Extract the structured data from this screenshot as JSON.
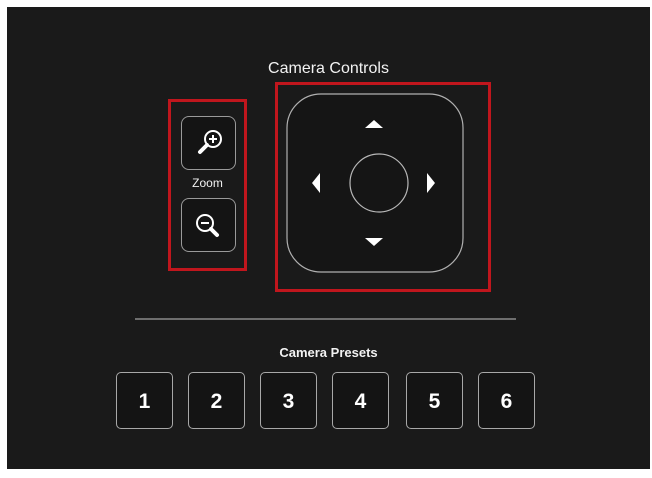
{
  "camera_controls": {
    "title": "Camera Controls",
    "zoom": {
      "label": "Zoom",
      "zoom_in_icon": "zoom-in-magnifier-icon",
      "zoom_out_icon": "zoom-out-magnifier-icon"
    },
    "pan_tilt": {
      "up_icon": "arrow-up-icon",
      "down_icon": "arrow-down-icon",
      "left_icon": "arrow-left-icon",
      "right_icon": "arrow-right-icon",
      "center_icon": "center-circle-icon"
    }
  },
  "presets": {
    "title": "Camera Presets",
    "items": [
      {
        "label": "1"
      },
      {
        "label": "2"
      },
      {
        "label": "3"
      },
      {
        "label": "4"
      },
      {
        "label": "5"
      },
      {
        "label": "6"
      }
    ]
  },
  "colors": {
    "background": "#1a1a1a",
    "highlight_border": "#c0161d",
    "button_border": "#a8a8a8",
    "text": "#ffffff"
  }
}
